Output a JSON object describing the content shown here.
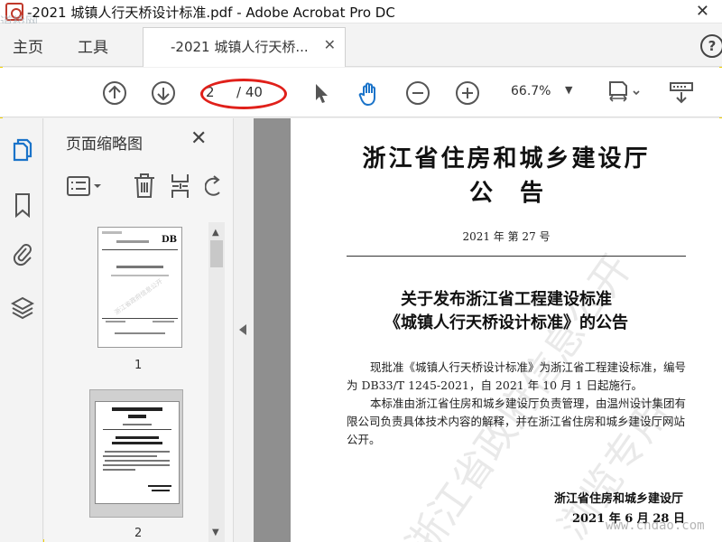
{
  "window": {
    "title": "-2021 城镇人行天桥设计标准.pdf - Adobe Acrobat Pro DC",
    "corner_watermark": "道桥网"
  },
  "tabs": {
    "home": "主页",
    "tools": "工具",
    "document": "-2021 城镇人行天桥..."
  },
  "toolbar": {
    "current_page": "2",
    "total_pages": "/ 40",
    "zoom": "66.7%",
    "icons": [
      "prev-page-icon",
      "next-page-icon",
      "select-pointer-icon",
      "hand-tool-icon",
      "zoom-out-icon",
      "zoom-in-icon",
      "page-fit-icon",
      "scroll-mode-icon"
    ]
  },
  "sidebar": {
    "icons": [
      "page-thumbnails-icon",
      "bookmarks-icon",
      "attachments-icon",
      "layers-icon"
    ]
  },
  "thumbnails_panel": {
    "title": "页面缩略图",
    "thumbs": [
      {
        "label": "1"
      },
      {
        "label": "2"
      }
    ]
  },
  "document": {
    "heading_line1": "浙江省住房和城乡建设厅",
    "heading_line2": "公告",
    "notice_number": "2021 年 第 27 号",
    "subject_line1": "关于发布浙江省工程建设标准",
    "subject_line2": "《城镇人行天桥设计标准》的公告",
    "paragraph1": "现批准《城镇人行天桥设计标准》为浙江省工程建设标准，编号为 DB33/T 1245-2021，自 2021 年 10 月 1 日起施行。",
    "paragraph2": "本标准由浙江省住房和城乡建设厅负责管理，由温州设计集团有限公司负责具体技术内容的解释，并在浙江省住房和城乡建设厅网站公开。",
    "signature": "浙江省住房和城乡建设厅",
    "date": "2021 年 6 月 28 日",
    "watermark_text_1": "浙江省政府信息公开",
    "watermark_text_2": "浏览专用",
    "url_watermark": "www.cndao.com"
  },
  "colors": {
    "accent_red": "#e0201a",
    "frame_yellow": "#f2d100",
    "doc_bg": "#8f8f8f"
  }
}
